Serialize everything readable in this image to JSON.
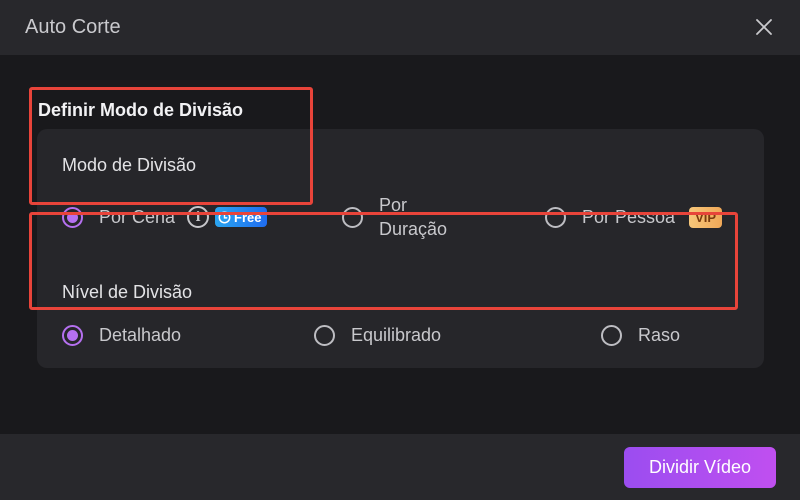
{
  "window": {
    "title": "Auto Corte"
  },
  "section": {
    "title": "Definir Modo de Divisão"
  },
  "split_mode": {
    "label": "Modo de Divisão",
    "options": [
      {
        "label": "Por Cena",
        "checked": true,
        "badge": "Free"
      },
      {
        "label_line1": "Por",
        "label_line2": "Duração",
        "checked": false
      },
      {
        "label": "Por Pessoa",
        "checked": false,
        "badge": "VIP"
      }
    ]
  },
  "split_level": {
    "label": "Nível de Divisão",
    "options": [
      {
        "label": "Detalhado",
        "checked": true
      },
      {
        "label": "Equilibrado",
        "checked": false
      },
      {
        "label": "Raso",
        "checked": false
      }
    ]
  },
  "footer": {
    "primary_button": "Dividir Vídeo"
  },
  "colors": {
    "accent": "#b570f0",
    "highlight_border": "#e8443a",
    "free_badge": "#1f8af0",
    "vip_badge": "#f3b86a"
  }
}
